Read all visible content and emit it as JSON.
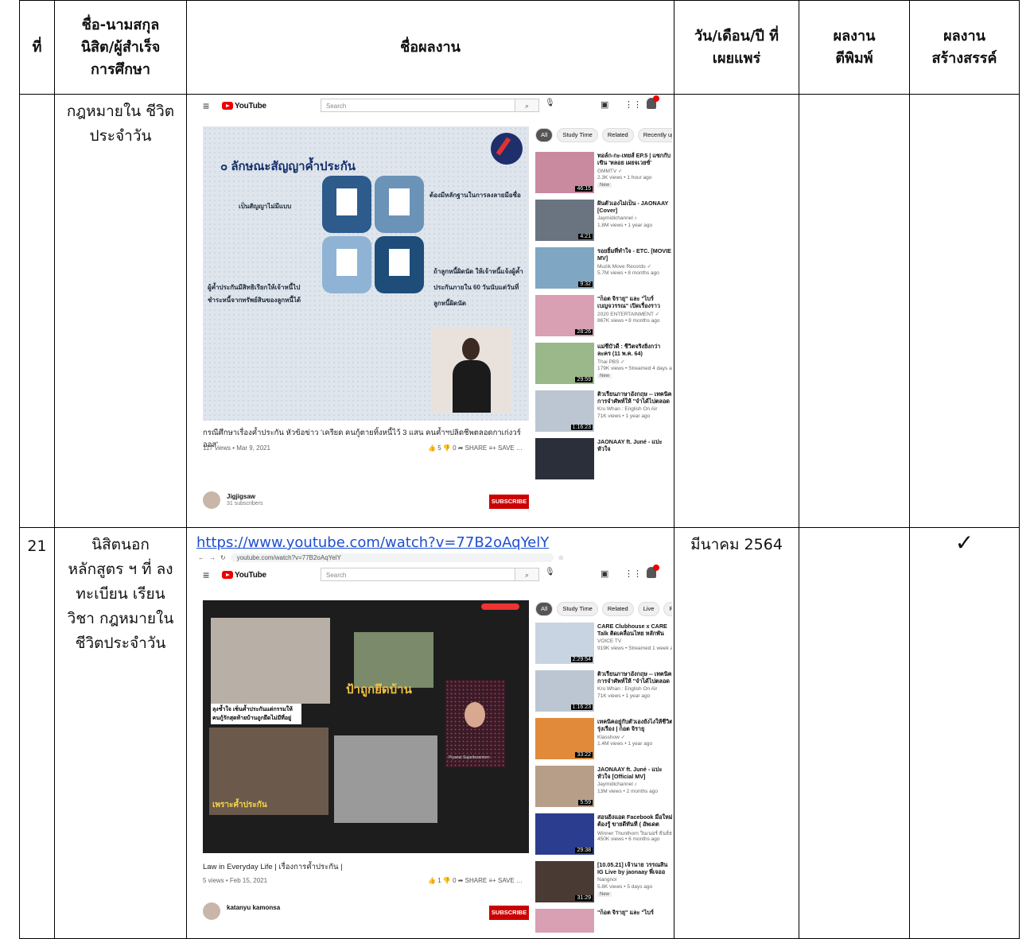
{
  "table": {
    "headers": {
      "no": "ที่",
      "name": "ชื่อ-นามสกุล นิสิต/ผู้สำเร็จ การศึกษา",
      "work": "ชื่อผลงาน",
      "date": "วัน/เดือน/ปี ที่เผยแพร่",
      "published": "ผลงาน ตีพิมพ์",
      "creative": "ผลงาน สร้างสรรค์"
    },
    "rows": [
      {
        "no": "",
        "name": "กฎหมายใน ชีวิตประจำวัน",
        "link": "",
        "date": "",
        "published_mark": "",
        "creative_mark": ""
      },
      {
        "no": "21",
        "name": "นิสิตนอก หลักสูตร ฯ ที่ ลงทะเบียน เรียนวิชา กฎหมายใน ชีวิตประจำวัน",
        "link": "https://www.youtube.com/watch?v=77B2oAqYelY",
        "date": "มีนาคม 2564",
        "published_mark": "",
        "creative_mark": "✓"
      }
    ]
  },
  "yt1": {
    "logo": "YouTube",
    "search_placeholder": "Search",
    "chips": [
      "All",
      "Study Time",
      "Related",
      "Recently uploaded"
    ],
    "slide_heading": "๐ ลักษณะสัญญาค้ำประกัน",
    "slide_labels": [
      "เป็นสัญญาไม่มีแบบ",
      "ต้องมีหลักฐานในการลงลายมือชื่อ",
      "ผู้ค้ำประกันมีสิทธิเรียกให้เจ้าหนี้ไป",
      "ชำระหนี้จากทรัพย์สินของลูกหนี้ได้",
      "ถ้าลูกหนี้ผิดนัด ให้เจ้าหนี้แจ้งผู้ค้ำ",
      "ประกันภายใน 60 วันนับแต่วันที่",
      "ลูกหนี้ผิดนัด"
    ],
    "video_title": "กรณีศึกษาเรื่องค้ำประกัน หัวข้อข่าว 'เครียด คนกู้ตายทิ้งหนี้ไว้ 3 แสน คนค้ำฯปลิดชีพตลอดกาเก่งวร์ออส'",
    "video_meta": "117 views • Mar 9, 2021",
    "actions": "👍 5   👎 0   ➦ SHARE   ≡+ SAVE   …",
    "channel": "Jigjigsaw",
    "subs": "31 subscribers",
    "subscribe": "SUBSCRIBE",
    "recs": [
      {
        "title": "ทอล์ก-กะ-เทยส์ EP.5 | แซกกับเขิน 'หลอย เผยจเวยซ์'",
        "channel": "GMMTV ✓",
        "views": "2.3K views • 1 hour ago",
        "duration": "46:15",
        "new": "New",
        "color": "#c98aa0"
      },
      {
        "title": "ฝันตัวเองไม่เป็น - JAONAAY [Cover]",
        "channel": "Jaymidichannel ♪",
        "views": "1.8M views • 1 year ago",
        "duration": "4:21",
        "new": "",
        "color": "#6a7480"
      },
      {
        "title": "รอยยิ้มที่ทำใจ - ETC. [MOVIE MV]",
        "channel": "Muzik Move Records ✓",
        "views": "5.7M views • 8 months ago",
        "duration": "9:32",
        "new": "",
        "color": "#7fa7c4"
      },
      {
        "title": "\"ก็อต จิรายุ\" และ \"ไบร์ เบญจวรรณ\" เปิดเรื่องราวความรั..",
        "channel": "2020 ENTERTAINMENT ✓",
        "views": "867K views • 8 months ago",
        "duration": "28:26",
        "new": "",
        "color": "#d9a0b4"
      },
      {
        "title": "แม่ชีบัวดี : ชีวิตจริงยิ่งกว่าละคร (11 พ.ค. 64)",
        "channel": "Thai PBS ✓",
        "views": "179K views • Streamed 4 days ago",
        "duration": "29:59",
        "new": "New",
        "color": "#9ab88a"
      },
      {
        "title": "ติวเรียนภาษาอังกฤษ -- เทคนิคการจำศัพท์ให้ \"จำได้ไปตลอดชีวิต\"..",
        "channel": "Kru Whan : English On Air",
        "views": "71K views • 1 year ago",
        "duration": "1:16:23",
        "new": "",
        "color": "#bcc6d2"
      },
      {
        "title": "JAONAAY ft. Juné - แปะหัวใจ",
        "channel": "",
        "views": "",
        "duration": "",
        "new": "",
        "color": "#2b2f3a"
      }
    ]
  },
  "yt2": {
    "url": "youtube.com/watch?v=77B2oAqYelY",
    "logo": "YouTube",
    "search_placeholder": "Search",
    "chips": [
      "All",
      "Study Time",
      "Related",
      "Live",
      "Recent"
    ],
    "slide_texts": [
      "ป้าถูกยึดบ้าน",
      "ลุงช้ำใจ เซ็นค้ำประกันแต่กรรมให้คนกู้รักสุดท้ายบ้านถูกยึดไม่มีที่อยู่",
      "เพราะค้ำประกัน"
    ],
    "presenter_name": "Piyanut Sujaritsoontorn",
    "video_title": "Law in Everyday Life | เรื่องการค้ำประกัน |",
    "video_meta": "5 views • Feb 15, 2021",
    "actions": "👍 1   👎 0   ➦ SHARE   ≡+ SAVE   …",
    "channel": "katanyu kamonsa",
    "subs": "",
    "subscribe": "SUBSCRIBE",
    "recs": [
      {
        "title": "CARE Clubhouse x CARE Talk ติดเคลื่อนไทย หลักพันวิกฤติโควิ",
        "channel": "VOICE TV",
        "views": "919K views • Streamed 1 week ago",
        "duration": "2:29:54",
        "new": "",
        "color": "#c9d4e2"
      },
      {
        "title": "ติวเรียนภาษาอังกฤษ -- เทคนิคการจำศัพท์ให้ \"จำได้ไปตลอดชีวิต\"..",
        "channel": "Kru Whan : English On Air",
        "views": "71K views • 1 year ago",
        "duration": "1:16:23",
        "new": "",
        "color": "#bcc6d2"
      },
      {
        "title": "เทคนิคอยู่กับตัวเองยังไงให้ชีวิตรุ่งเรือง | ก็อต จิรายุ",
        "channel": "Klasshow ✓",
        "views": "1.4M views • 1 year ago",
        "duration": "33:22",
        "new": "",
        "color": "#e08a3a"
      },
      {
        "title": "JAONAAY ft. Juné - แปะหัวใจ [Official MV]",
        "channel": "Jaymidichannel ♪",
        "views": "13M views • 2 months ago",
        "duration": "5:59",
        "new": "",
        "color": "#b79e88"
      },
      {
        "title": "สอนยิงแอด Facebook มือใหม่ ต้องรู้ ขายดีทันที ( อัพเดตล่าสุด..",
        "channel": "Winner Thunthorn วินเนอร์ ธันธ์ธร",
        "views": "450K views • 6 months ago",
        "duration": "29:38",
        "new": "",
        "color": "#2a3d8f"
      },
      {
        "title": "[10.05.21] เจ้านาย วรรณสิน IG Live by jaonaay พี่เจออแพ..",
        "channel": "Nangnoi",
        "views": "5.8K views • 5 days ago",
        "duration": "31:29",
        "new": "New",
        "color": "#4a3a34"
      },
      {
        "title": "\"ก็อต จิรายุ\" และ \"ไบร์",
        "channel": "",
        "views": "",
        "duration": "",
        "new": "",
        "color": "#d9a0b4"
      }
    ]
  }
}
